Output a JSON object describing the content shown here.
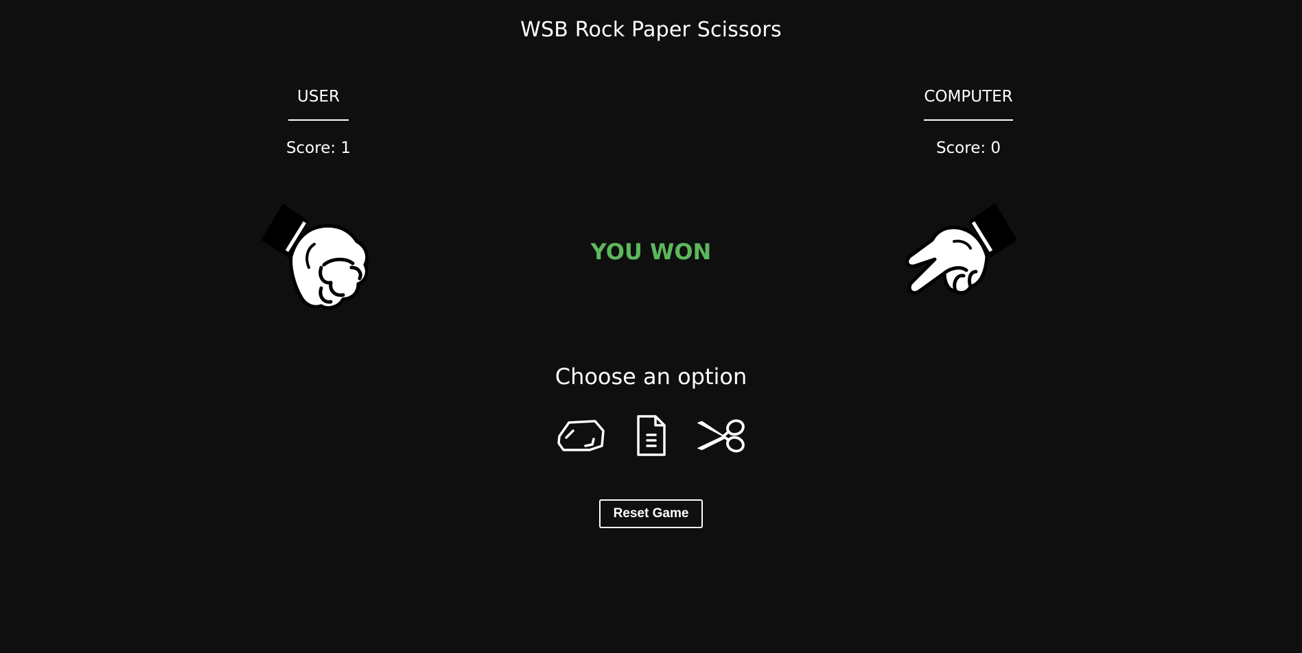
{
  "app": {
    "title": "WSB Rock Paper Scissors"
  },
  "user": {
    "name": "USER",
    "score_text": "Score: 1",
    "hand_icon": "rock-hand-icon"
  },
  "computer": {
    "name": "COMPUTER",
    "score_text": "Score: 0",
    "hand_icon": "scissors-hand-icon"
  },
  "result": {
    "text": "YOU WON",
    "color": "#5cb85c"
  },
  "options": {
    "label": "Choose an option",
    "items": [
      {
        "name": "rock",
        "icon": "rock-icon"
      },
      {
        "name": "paper",
        "icon": "paper-icon"
      },
      {
        "name": "scissors",
        "icon": "scissors-icon"
      }
    ]
  },
  "controls": {
    "reset_label": "Reset Game"
  },
  "theme": {
    "background": "#0f0f0f",
    "foreground": "#ffffff",
    "win": "#5cb85c"
  }
}
